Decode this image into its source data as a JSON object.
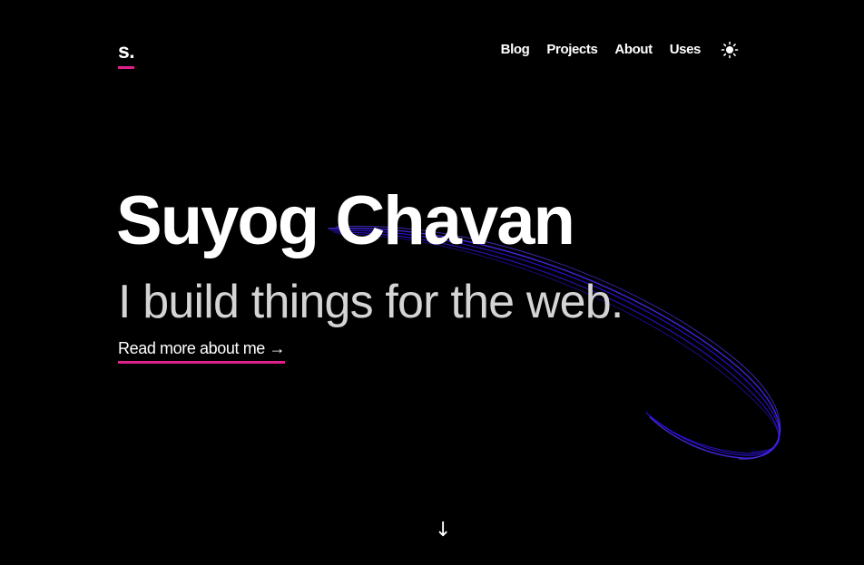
{
  "header": {
    "logo_text": "s.",
    "nav": [
      {
        "label": "Blog"
      },
      {
        "label": "Projects"
      },
      {
        "label": "About"
      },
      {
        "label": "Uses"
      }
    ],
    "theme_toggle_icon": "sun-icon"
  },
  "hero": {
    "name": "Suyog Chavan",
    "tagline": "I build things for the web.",
    "cta_label": "Read more about me →",
    "scroll_arrow": "↓"
  },
  "colors": {
    "background": "#000000",
    "accent_underline": "#e0208a",
    "orbit_stroke": "#3b1cff"
  }
}
